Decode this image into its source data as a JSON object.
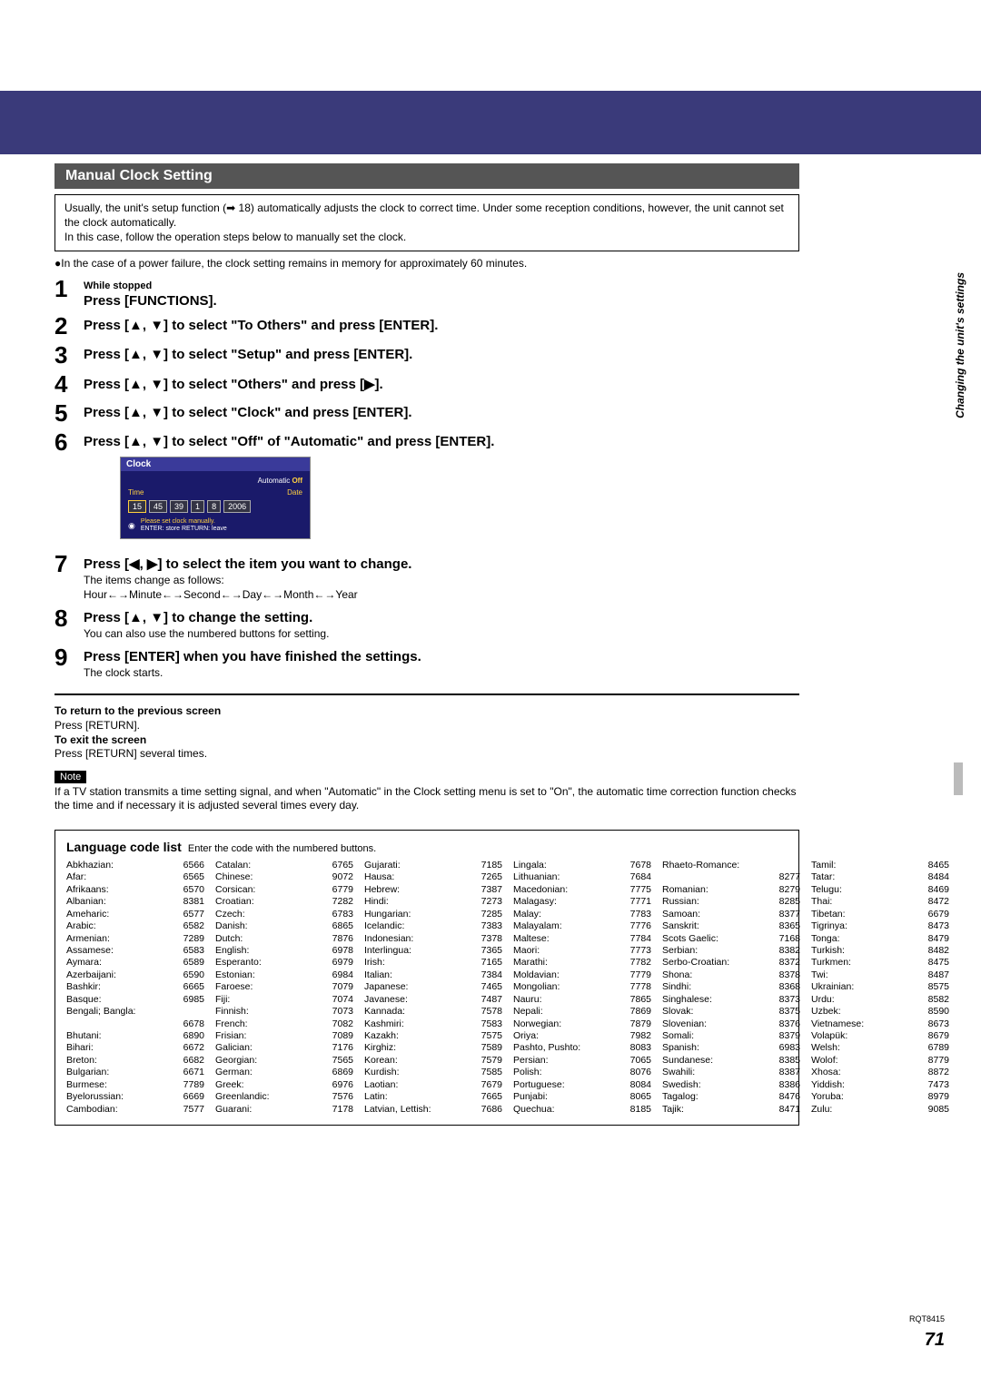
{
  "section_title": "Manual Clock Setting",
  "note_box": "Usually, the unit's setup function (➡ 18) automatically adjusts the clock to correct time. Under some reception conditions, however, the unit cannot set the clock automatically.\nIn this case, follow the operation steps below to manually set the clock.",
  "bullet_line": "●In the case of a power failure, the clock setting remains in memory for approximately 60 minutes.",
  "side_label": "Changing the unit's settings",
  "steps": [
    {
      "num": "1",
      "pre": "While stopped",
      "main": "Press [FUNCTIONS]."
    },
    {
      "num": "2",
      "main": "Press [▲, ▼] to select \"To Others\" and press [ENTER]."
    },
    {
      "num": "3",
      "main": "Press [▲, ▼] to select \"Setup\" and press [ENTER]."
    },
    {
      "num": "4",
      "main": "Press [▲, ▼] to select \"Others\" and press [▶]."
    },
    {
      "num": "5",
      "main": "Press [▲, ▼] to select \"Clock\" and press [ENTER]."
    },
    {
      "num": "6",
      "main": "Press [▲, ▼] to select \"Off\" of \"Automatic\" and press [ENTER]."
    },
    {
      "num": "7",
      "main": "Press [◀, ▶] to select the item you want to change.",
      "sub1": "The items change as follows:",
      "sub2": "Hour←→Minute←→Second←→Day←→Month←→Year"
    },
    {
      "num": "8",
      "main": "Press [▲, ▼] to change the setting.",
      "sub1": "You can also use the numbered buttons for setting."
    },
    {
      "num": "9",
      "main": "Press [ENTER] when you have finished the settings.",
      "sub1": "The clock starts."
    }
  ],
  "clock_ui": {
    "title": "Clock",
    "automatic_label": "Automatic",
    "automatic_value": "Off",
    "time_label": "Time",
    "date_label": "Date",
    "values": [
      "15",
      "45",
      "39",
      "1",
      "8",
      "2006"
    ],
    "hint1": "Please set clock manually.",
    "hint2": "ENTER: store    RETURN: leave"
  },
  "return_block": {
    "t1": "To return to the previous screen",
    "l1": "Press [RETURN].",
    "t2": "To exit the screen",
    "l2": "Press [RETURN] several times."
  },
  "note_label": "Note",
  "note_text": "If a TV station transmits a time setting signal, and when \"Automatic\" in the Clock setting menu is set to \"On\", the automatic time correction function checks the time and if necessary it is adjusted several times every day.",
  "lang_title": "Language code list",
  "lang_intro": "Enter the code with the numbered buttons.",
  "lang_cols": [
    [
      {
        "n": "Abkhazian:",
        "c": "6566"
      },
      {
        "n": "Afar:",
        "c": "6565"
      },
      {
        "n": "Afrikaans:",
        "c": "6570"
      },
      {
        "n": "Albanian:",
        "c": "8381"
      },
      {
        "n": "Ameharic:",
        "c": "6577"
      },
      {
        "n": "Arabic:",
        "c": "6582"
      },
      {
        "n": "Armenian:",
        "c": "7289"
      },
      {
        "n": "Assamese:",
        "c": "6583"
      },
      {
        "n": "Aymara:",
        "c": "6589"
      },
      {
        "n": "Azerbaijani:",
        "c": "6590"
      },
      {
        "n": "Bashkir:",
        "c": "6665"
      },
      {
        "n": "Basque:",
        "c": "6985"
      },
      {
        "n": "Bengali; Bangla:",
        "c": ""
      },
      {
        "n": "",
        "c": "6678"
      },
      {
        "n": "Bhutani:",
        "c": "6890"
      },
      {
        "n": "Bihari:",
        "c": "6672"
      },
      {
        "n": "Breton:",
        "c": "6682"
      },
      {
        "n": "Bulgarian:",
        "c": "6671"
      },
      {
        "n": "Burmese:",
        "c": "7789"
      },
      {
        "n": "Byelorussian:",
        "c": "6669"
      },
      {
        "n": "Cambodian:",
        "c": "7577"
      }
    ],
    [
      {
        "n": "Catalan:",
        "c": "6765"
      },
      {
        "n": "Chinese:",
        "c": "9072"
      },
      {
        "n": "Corsican:",
        "c": "6779"
      },
      {
        "n": "Croatian:",
        "c": "7282"
      },
      {
        "n": "Czech:",
        "c": "6783"
      },
      {
        "n": "Danish:",
        "c": "6865"
      },
      {
        "n": "Dutch:",
        "c": "7876"
      },
      {
        "n": "English:",
        "c": "6978"
      },
      {
        "n": "Esperanto:",
        "c": "6979"
      },
      {
        "n": "Estonian:",
        "c": "6984"
      },
      {
        "n": "Faroese:",
        "c": "7079"
      },
      {
        "n": "Fiji:",
        "c": "7074"
      },
      {
        "n": "Finnish:",
        "c": "7073"
      },
      {
        "n": "French:",
        "c": "7082"
      },
      {
        "n": "Frisian:",
        "c": "7089"
      },
      {
        "n": "Galician:",
        "c": "7176"
      },
      {
        "n": "Georgian:",
        "c": "7565"
      },
      {
        "n": "German:",
        "c": "6869"
      },
      {
        "n": "Greek:",
        "c": "6976"
      },
      {
        "n": "Greenlandic:",
        "c": "7576"
      },
      {
        "n": "Guarani:",
        "c": "7178"
      }
    ],
    [
      {
        "n": "Gujarati:",
        "c": "7185"
      },
      {
        "n": "Hausa:",
        "c": "7265"
      },
      {
        "n": "Hebrew:",
        "c": "7387"
      },
      {
        "n": "Hindi:",
        "c": "7273"
      },
      {
        "n": "Hungarian:",
        "c": "7285"
      },
      {
        "n": "Icelandic:",
        "c": "7383"
      },
      {
        "n": "Indonesian:",
        "c": "7378"
      },
      {
        "n": "Interlingua:",
        "c": "7365"
      },
      {
        "n": "Irish:",
        "c": "7165"
      },
      {
        "n": "Italian:",
        "c": "7384"
      },
      {
        "n": "Japanese:",
        "c": "7465"
      },
      {
        "n": "Javanese:",
        "c": "7487"
      },
      {
        "n": "Kannada:",
        "c": "7578"
      },
      {
        "n": "Kashmiri:",
        "c": "7583"
      },
      {
        "n": "Kazakh:",
        "c": "7575"
      },
      {
        "n": "Kirghiz:",
        "c": "7589"
      },
      {
        "n": "Korean:",
        "c": "7579"
      },
      {
        "n": "Kurdish:",
        "c": "7585"
      },
      {
        "n": "Laotian:",
        "c": "7679"
      },
      {
        "n": "Latin:",
        "c": "7665"
      },
      {
        "n": "Latvian, Lettish:",
        "c": "7686"
      }
    ],
    [
      {
        "n": "Lingala:",
        "c": "7678"
      },
      {
        "n": "Lithuanian:",
        "c": "7684"
      },
      {
        "n": "Macedonian:",
        "c": "7775"
      },
      {
        "n": "Malagasy:",
        "c": "7771"
      },
      {
        "n": "Malay:",
        "c": "7783"
      },
      {
        "n": "Malayalam:",
        "c": "7776"
      },
      {
        "n": "Maltese:",
        "c": "7784"
      },
      {
        "n": "Maori:",
        "c": "7773"
      },
      {
        "n": "Marathi:",
        "c": "7782"
      },
      {
        "n": "Moldavian:",
        "c": "7779"
      },
      {
        "n": "Mongolian:",
        "c": "7778"
      },
      {
        "n": "Nauru:",
        "c": "7865"
      },
      {
        "n": "Nepali:",
        "c": "7869"
      },
      {
        "n": "Norwegian:",
        "c": "7879"
      },
      {
        "n": "Oriya:",
        "c": "7982"
      },
      {
        "n": "Pashto, Pushto:",
        "c": "8083"
      },
      {
        "n": "Persian:",
        "c": "7065"
      },
      {
        "n": "Polish:",
        "c": "8076"
      },
      {
        "n": "Portuguese:",
        "c": "8084"
      },
      {
        "n": "Punjabi:",
        "c": "8065"
      },
      {
        "n": "Quechua:",
        "c": "8185"
      }
    ],
    [
      {
        "n": "Rhaeto-Romance:",
        "c": ""
      },
      {
        "n": "",
        "c": "8277"
      },
      {
        "n": "Romanian:",
        "c": "8279"
      },
      {
        "n": "Russian:",
        "c": "8285"
      },
      {
        "n": "Samoan:",
        "c": "8377"
      },
      {
        "n": "Sanskrit:",
        "c": "8365"
      },
      {
        "n": "Scots Gaelic:",
        "c": "7168"
      },
      {
        "n": "Serbian:",
        "c": "8382"
      },
      {
        "n": "Serbo-Croatian:",
        "c": "8372"
      },
      {
        "n": "Shona:",
        "c": "8378"
      },
      {
        "n": "Sindhi:",
        "c": "8368"
      },
      {
        "n": "Singhalese:",
        "c": "8373"
      },
      {
        "n": "Slovak:",
        "c": "8375"
      },
      {
        "n": "Slovenian:",
        "c": "8376"
      },
      {
        "n": "Somali:",
        "c": "8379"
      },
      {
        "n": "Spanish:",
        "c": "6983"
      },
      {
        "n": "Sundanese:",
        "c": "8385"
      },
      {
        "n": "Swahili:",
        "c": "8387"
      },
      {
        "n": "Swedish:",
        "c": "8386"
      },
      {
        "n": "Tagalog:",
        "c": "8476"
      },
      {
        "n": "Tajik:",
        "c": "8471"
      }
    ],
    [
      {
        "n": "Tamil:",
        "c": "8465"
      },
      {
        "n": "Tatar:",
        "c": "8484"
      },
      {
        "n": "Telugu:",
        "c": "8469"
      },
      {
        "n": "Thai:",
        "c": "8472"
      },
      {
        "n": "Tibetan:",
        "c": "6679"
      },
      {
        "n": "Tigrinya:",
        "c": "8473"
      },
      {
        "n": "Tonga:",
        "c": "8479"
      },
      {
        "n": "Turkish:",
        "c": "8482"
      },
      {
        "n": "Turkmen:",
        "c": "8475"
      },
      {
        "n": "Twi:",
        "c": "8487"
      },
      {
        "n": "Ukrainian:",
        "c": "8575"
      },
      {
        "n": "Urdu:",
        "c": "8582"
      },
      {
        "n": "Uzbek:",
        "c": "8590"
      },
      {
        "n": "Vietnamese:",
        "c": "8673"
      },
      {
        "n": "Volapük:",
        "c": "8679"
      },
      {
        "n": "Welsh:",
        "c": "6789"
      },
      {
        "n": "Wolof:",
        "c": "8779"
      },
      {
        "n": "Xhosa:",
        "c": "8872"
      },
      {
        "n": "Yiddish:",
        "c": "7473"
      },
      {
        "n": "Yoruba:",
        "c": "8979"
      },
      {
        "n": "Zulu:",
        "c": "9085"
      }
    ]
  ],
  "doc_code": "RQT8415",
  "page_num": "71"
}
